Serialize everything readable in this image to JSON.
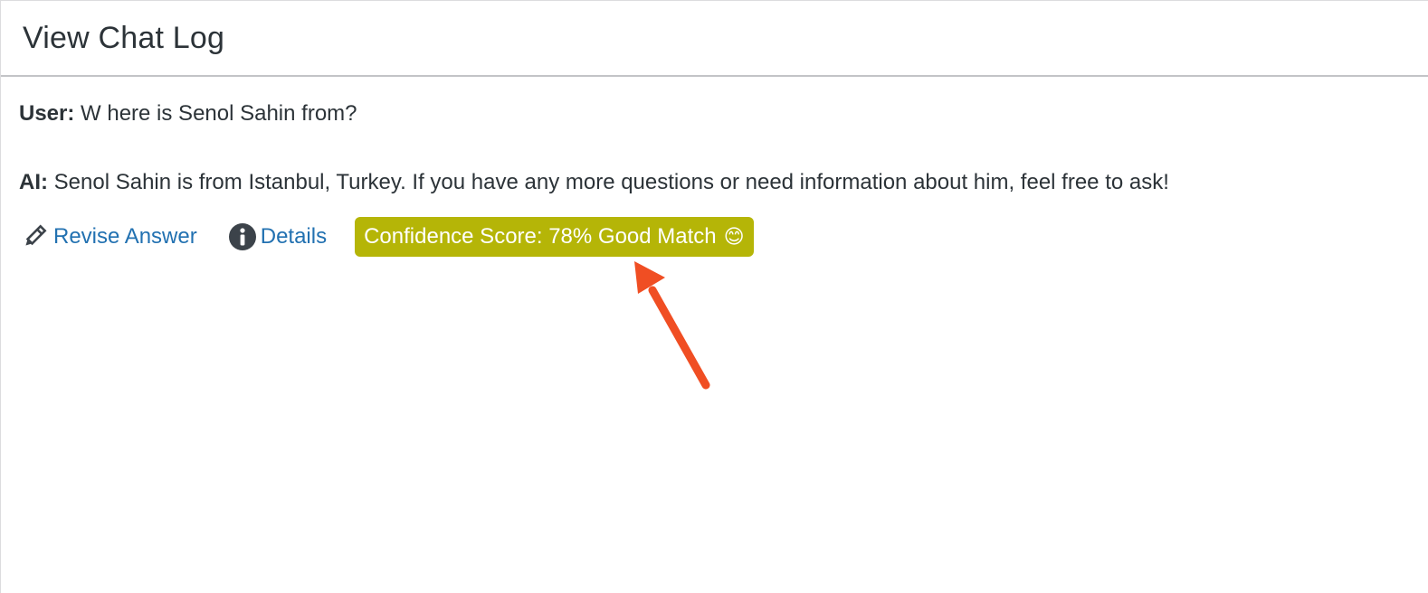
{
  "header": {
    "title": "View Chat Log"
  },
  "log": {
    "user_label": "User:",
    "user_text": "W here is Senol Sahin from?",
    "ai_label": "AI:",
    "ai_text": "Senol Sahin is from Istanbul, Turkey. If you have any more questions or need information about him, feel free to ask!"
  },
  "actions": {
    "revise_label": "Revise Answer",
    "revise_icon": "pencil-icon",
    "details_label": "Details",
    "details_icon": "info-icon",
    "confidence_label": "Confidence Score: 78% Good Match",
    "confidence_emoji": "😊",
    "confidence_value": 78,
    "confidence_color": "#b5b507"
  },
  "colors": {
    "link": "#2271b1",
    "annotation_arrow": "#f04e23"
  }
}
